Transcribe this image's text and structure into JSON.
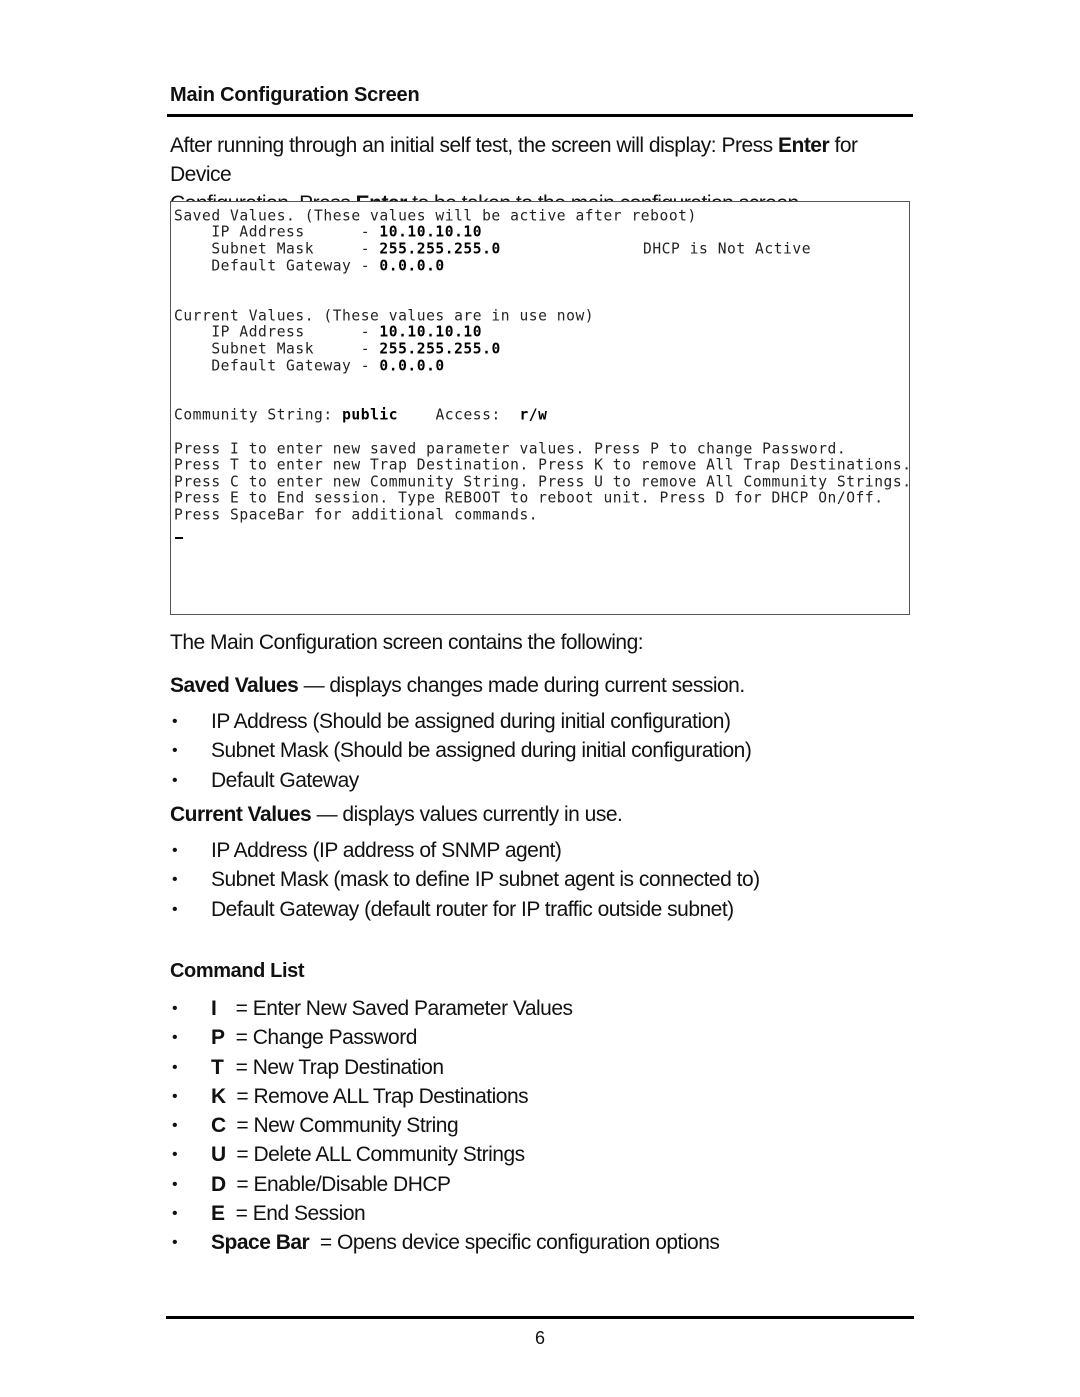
{
  "document": {
    "section_title": "Main Configuration Screen",
    "intro": {
      "line1_a": "After running through an initial self test, the screen will display: Press ",
      "line1_b": "Enter",
      "line1_c": " for Device",
      "line2_a": "Configuration.  Press ",
      "line2_b": "Enter",
      "line2_c": " to be taken to the main configuration screen."
    },
    "terminal": {
      "saved_header": "Saved Values. (These values will be active after reboot)",
      "saved_ip_label": "    IP Address      - ",
      "saved_ip_value": "10.10.10.10",
      "saved_mask_label": "    Subnet Mask     - ",
      "saved_mask_value": "255.255.255.0",
      "dhcp_status": "DHCP is Not Active",
      "saved_gw_label": "    Default Gateway - ",
      "saved_gw_value": "0.0.0.0",
      "current_header": "Current Values. (These values are in use now)",
      "current_ip_label": "    IP Address      - ",
      "current_ip_value": "10.10.10.10",
      "current_mask_label": "    Subnet Mask     - ",
      "current_mask_value": "255.255.255.0",
      "current_gw_label": "    Default Gateway - ",
      "current_gw_value": "0.0.0.0",
      "community_label": "Community String: ",
      "community_value": "public",
      "access_label": "    Access:  ",
      "access_value": "r/w",
      "cmd_lines": [
        "Press I to enter new saved parameter values. Press P to change Password.",
        "Press T to enter new Trap Destination. Press K to remove All Trap Destinations.",
        "Press C to enter new Community String. Press U to remove All Community Strings.",
        "Press E to End session. Type REBOOT to reboot unit. Press D for DHCP On/Off.",
        "Press SpaceBar for additional commands."
      ]
    },
    "contains_text": "The Main Configuration screen contains the following:",
    "saved_values": {
      "term": "Saved Values",
      "desc": " — displays changes made during current session.",
      "items": [
        "IP Address (Should be assigned during initial configuration)",
        "Subnet Mask (Should be assigned during initial configuration)",
        "Default Gateway"
      ]
    },
    "current_values": {
      "term": "Current Values",
      "desc": " — displays values currently in use.",
      "items": [
        "IP Address (IP address of SNMP agent)",
        "Subnet Mask (mask to define IP subnet agent is connected to)",
        "Default Gateway (default router for IP traffic outside subnet)"
      ]
    },
    "command_list": {
      "title": "Command List",
      "items": [
        {
          "key": "I",
          "desc": "= Enter New Saved Parameter Values"
        },
        {
          "key": "P",
          "desc": "= Change Password"
        },
        {
          "key": "T",
          "desc": "= New Trap Destination"
        },
        {
          "key": "K",
          "desc": "= Remove ALL Trap Destinations"
        },
        {
          "key": "C",
          "desc": "= New Community String"
        },
        {
          "key": "U",
          "desc": "= Delete ALL Community Strings"
        },
        {
          "key": "D",
          "desc": "= Enable/Disable DHCP"
        },
        {
          "key": "E",
          "desc": "= End Session"
        },
        {
          "key": "Space Bar",
          "desc": "= Opens device specific configuration options"
        }
      ]
    },
    "bullet_char": "•",
    "page_number": "6"
  }
}
